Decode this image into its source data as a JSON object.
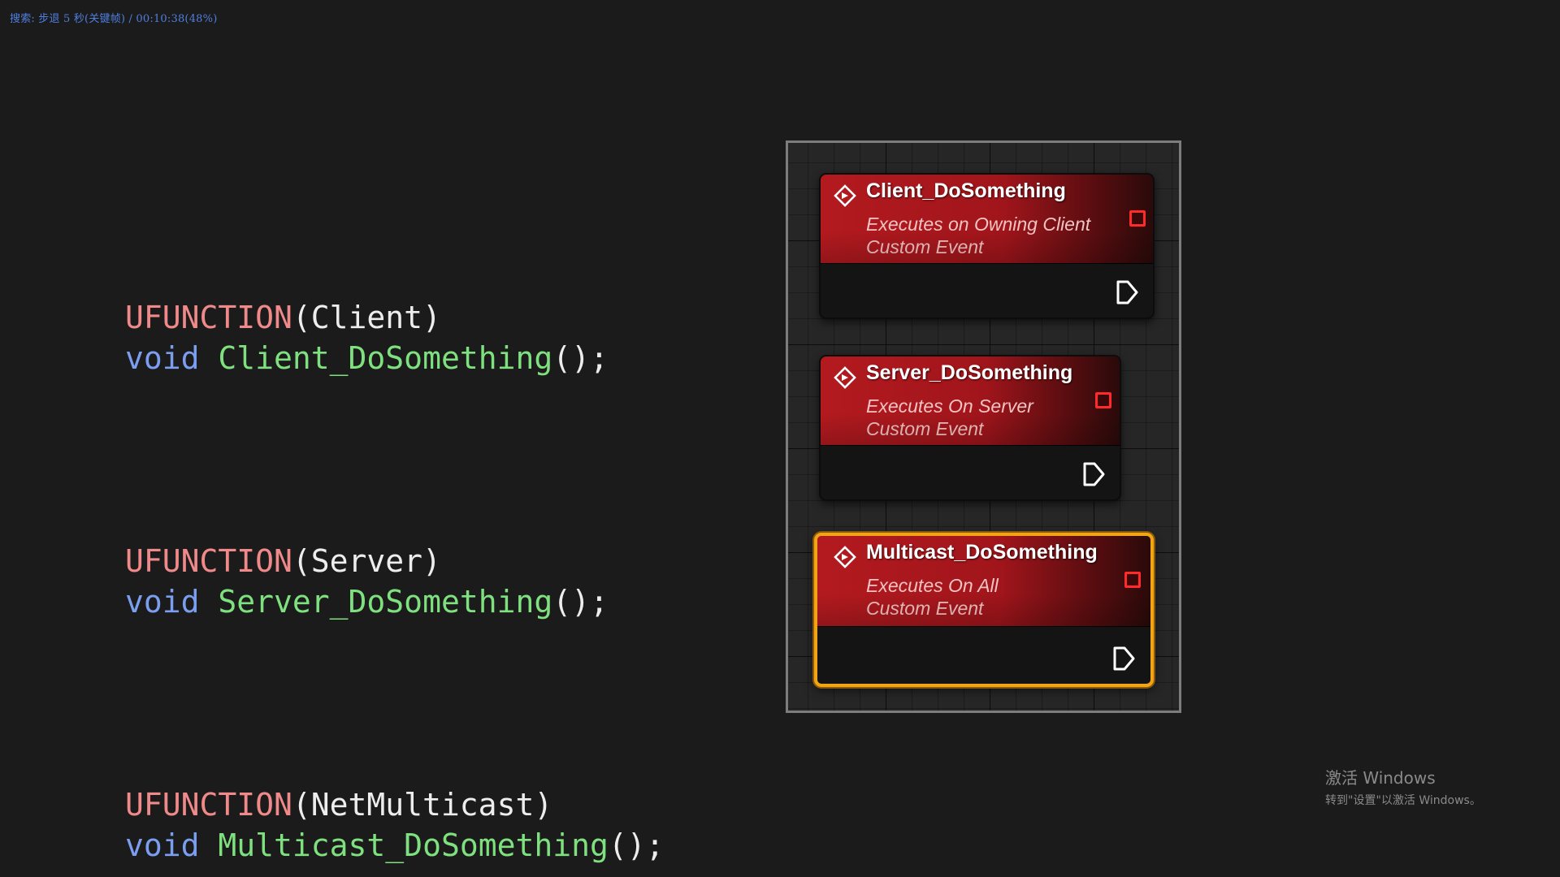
{
  "osd": {
    "text": "搜索: 步退 5 秒(关键帧) / 00:10:38(48%)"
  },
  "code": [
    {
      "macro": "UFUNCTION",
      "spec": "(Client)",
      "keyword": "void",
      "function": "Client_DoSomething",
      "tail": "();"
    },
    {
      "macro": "UFUNCTION",
      "spec": "(Server)",
      "keyword": "void",
      "function": "Server_DoSomething",
      "tail": "();"
    },
    {
      "macro": "UFUNCTION",
      "spec": "(NetMulticast)",
      "keyword": "void",
      "function": "Multicast_DoSomething",
      "tail": "();"
    }
  ],
  "graph": {
    "nodes": [
      {
        "title": "Client_DoSomething",
        "line1": "Executes on Owning Client",
        "line2": "Custom Event",
        "selected": false
      },
      {
        "title": "Server_DoSomething",
        "line1": "Executes On Server",
        "line2": "Custom Event",
        "selected": false
      },
      {
        "title": "Multicast_DoSomething",
        "line1": "Executes On All",
        "line2": "Custom Event",
        "selected": true
      }
    ],
    "colors": {
      "node_header": "#b31a1f",
      "selection_outline": "#f2a417",
      "delegate_pin": "#ff2a2a"
    },
    "icons": {
      "event": "custom-event-icon",
      "delegate": "delegate-pin-icon",
      "exec": "exec-output-pin-icon"
    }
  },
  "watermark": {
    "line1": "激活 Windows",
    "line2": "转到\"设置\"以激活 Windows。"
  }
}
